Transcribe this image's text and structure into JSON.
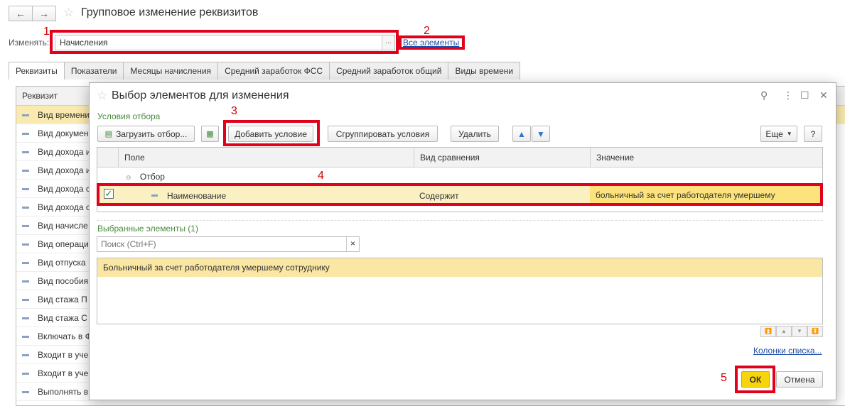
{
  "window": {
    "title": "Групповое изменение реквизитов",
    "back_icon": "←",
    "forward_icon": "→"
  },
  "change": {
    "label": "Изменять:",
    "value": "Начисления",
    "select_btn": "...",
    "all_link": "Все элементы"
  },
  "tabs": [
    "Реквизиты",
    "Показатели",
    "Месяцы начисления",
    "Средний заработок ФСС",
    "Средний заработок общий",
    "Виды времени"
  ],
  "bg_table": {
    "header": "Реквизит",
    "rows": [
      "Вид времени",
      "Вид докумен",
      "Вид дохода и",
      "Вид дохода и",
      "Вид дохода с",
      "Вид дохода с",
      "Вид начисле",
      "Вид операци",
      "Вид отпуска",
      "Вид пособия",
      "Вид стажа П",
      "Вид стажа С",
      "Включать в Ф",
      "Входит в уче",
      "Входит в уче",
      "Выполнять в"
    ]
  },
  "dialog": {
    "title": "Выбор элементов для изменения",
    "link_icon": "⚲",
    "menu_icon": "⋮",
    "maximize_icon": "☐",
    "close_icon": "✕",
    "filter_section": "Условия отбора",
    "buttons": {
      "load_filter": "Загрузить отбор...",
      "add_condition": "Добавить условие",
      "group_conditions": "Сгруппировать условия",
      "delete": "Удалить",
      "more": "Еще",
      "help": "?",
      "ok": "ОК",
      "cancel": "Отмена"
    },
    "columns": {
      "field": "Поле",
      "comparison": "Вид сравнения",
      "value": "Значение"
    },
    "filter_root": "Отбор",
    "condition": {
      "field": "Наименование",
      "comparison": "Содержит",
      "value": "больничный за счет работодателя умершему"
    },
    "selected_header": "Выбранные элементы (1)",
    "search_placeholder": "Поиск (Ctrl+F)",
    "search_clear": "×",
    "selected_items": [
      "Больничный за счет работодателя умершему сотруднику"
    ],
    "list_columns_link": "Колонки списка..."
  },
  "annotations": [
    "1",
    "2",
    "3",
    "4",
    "5"
  ]
}
